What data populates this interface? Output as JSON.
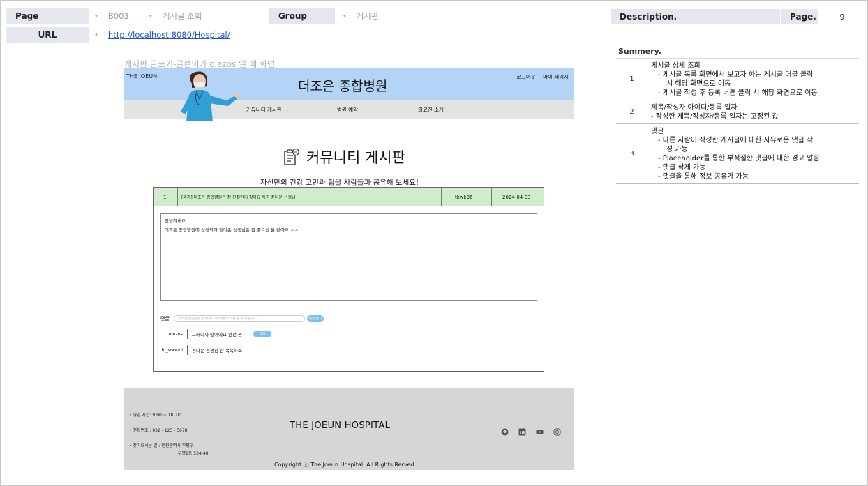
{
  "meta": {
    "page_label": "Page",
    "page_code": "B003",
    "page_name": "게시글 조회",
    "group_label": "Group",
    "group_value": "게시판",
    "url_label": "URL",
    "url_value": "http://localhost:8080/Hospital/"
  },
  "caption": "게시판 글쓰기-글쓴이가 olezos 일 때 화면",
  "site": {
    "brand": "THE JOEUN",
    "title": "더조은 종합병원",
    "top_links": [
      "로그아웃",
      "마이 페이지"
    ],
    "nav": [
      "커뮤니티 게시판",
      "병원 예약",
      "의료진 소개"
    ],
    "board_title": "커뮤니티 게시판",
    "board_subtitle": "자신만의 건강 고민과 팁을 사람들과 공유해 보세요!",
    "post": {
      "number": "1.",
      "title": "[외과] 더조은 종합병원은 참 친절한거 같아요 특히 정다운 선생님",
      "author": "tkwk36",
      "date": "2024-04-03",
      "content_line1": "안녕하세요",
      "content_line2": "더조은 종합병원에 신경외과 정다운 선생님은 참 좋으신 분 같아요 ㅎㅎ"
    },
    "comment_label": "댓글",
    "comment_placeholder": "부적절한 댓글은 관리자에 의해 무통보 삭제 될 수 있습니다.",
    "comment_submit": "댓글 달기",
    "comments": [
      {
        "user": "olezos",
        "text": "그러니까 말이에요 완전 짱",
        "action": "삭제"
      },
      {
        "user": "hi_soonni",
        "text": "정다운 선생님 참 똑똑하죠"
      }
    ],
    "footer": {
      "hours": "영업 시간: 9:00 ~ 18: 00",
      "phone": "전화번호 : 032 - 123 - 5678",
      "address_line1": "찾아오시는 길 : 인천광역시 부평구",
      "address_line2": "부평1동 534-48",
      "title": "THE JOEUN HOSPITAL",
      "copyright": "Copyright ⓒ The Joeun Hospital. All Rights Rerved",
      "icons": [
        "github-icon",
        "linkedin-icon",
        "youtube-icon",
        "instagram-icon"
      ]
    }
  },
  "right": {
    "description_label": "Description.",
    "page_label": "Page.",
    "page_number": "9",
    "summary_label": "Summery.",
    "rows": [
      {
        "num": "1",
        "lines": [
          "게시글 상세 조회",
          "-   게시글 목록 화면에서 보고자 하는 게시글 더블 클릭",
          "시 해당 화면으로 이동",
          "-   게시글 작성 후 등록 버튼 클릭 시 해당 화면으로 이동"
        ]
      },
      {
        "num": "2",
        "lines": [
          "제목/작성자 아이디/등록 일자",
          "- 작성한 제목/작성자/등록 일자는 고정된 값"
        ]
      },
      {
        "num": "3",
        "lines": [
          "댓글",
          "-   다른 사람이 작성한 게시글에 대한 자유로운 댓글 작",
          "성 가능",
          "-   Placeholder를 통한 부적절한 댓글에 대한 경고 알림",
          "-   댓글 삭제 가능",
          "-   댓글을 통해 정보 공유가 가능"
        ]
      }
    ]
  }
}
